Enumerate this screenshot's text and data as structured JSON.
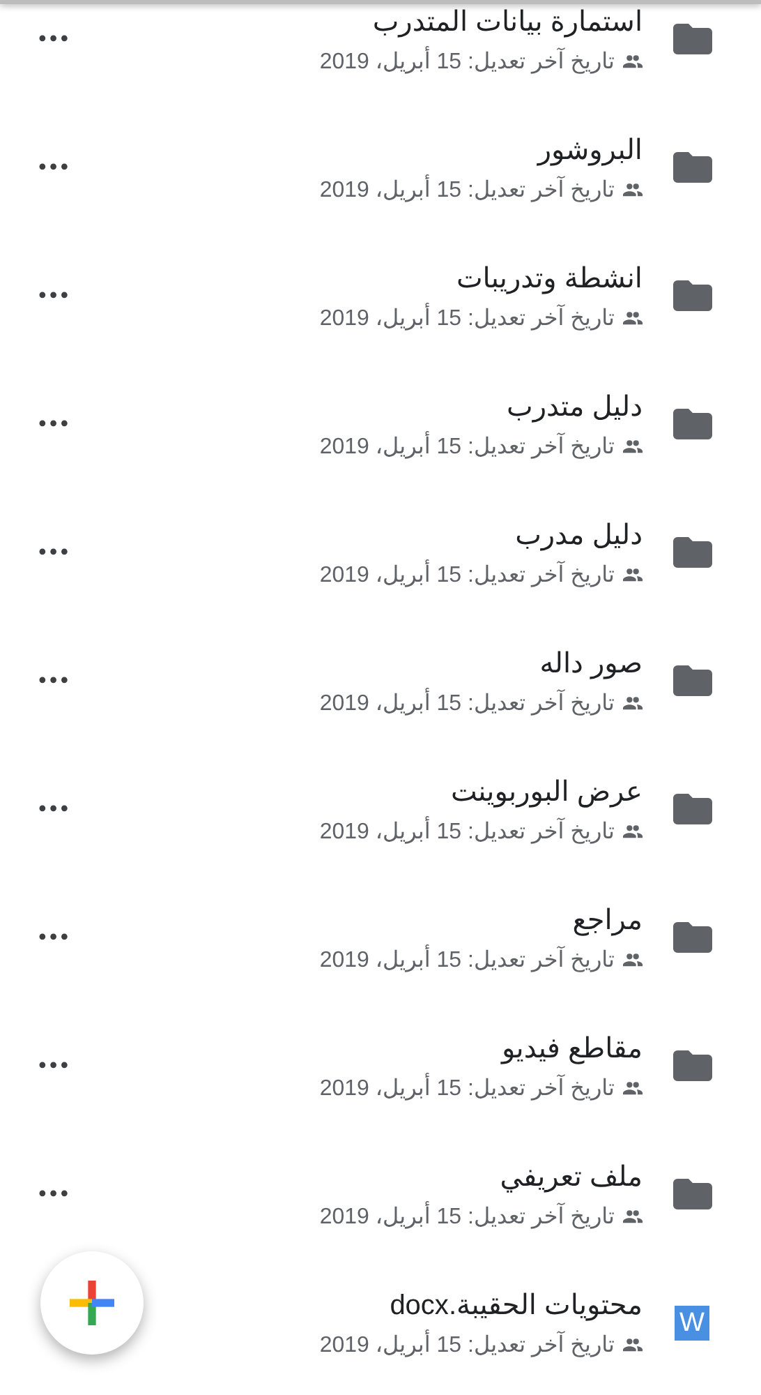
{
  "files": [
    {
      "kind": "folder",
      "name": "استمارة بيانات المتدرب",
      "modified": "تاريخ آخر تعديل: 15 أبريل، 2019",
      "shared": true,
      "menu": "•••"
    },
    {
      "kind": "folder",
      "name": "البروشور",
      "modified": "تاريخ آخر تعديل: 15 أبريل، 2019",
      "shared": true,
      "menu": "•••"
    },
    {
      "kind": "folder",
      "name": "انشطة وتدريبات",
      "modified": "تاريخ آخر تعديل: 15 أبريل، 2019",
      "shared": true,
      "menu": "•••"
    },
    {
      "kind": "folder",
      "name": "دليل متدرب",
      "modified": "تاريخ آخر تعديل: 15 أبريل، 2019",
      "shared": true,
      "menu": "•••"
    },
    {
      "kind": "folder",
      "name": "دليل مدرب",
      "modified": "تاريخ آخر تعديل: 15 أبريل، 2019",
      "shared": true,
      "menu": "•••"
    },
    {
      "kind": "folder",
      "name": "صور داله",
      "modified": "تاريخ آخر تعديل: 15 أبريل، 2019",
      "shared": true,
      "menu": "•••"
    },
    {
      "kind": "folder",
      "name": "عرض البوربوينت",
      "modified": "تاريخ آخر تعديل: 15 أبريل، 2019",
      "shared": true,
      "menu": "•••"
    },
    {
      "kind": "folder",
      "name": "مراجع",
      "modified": "تاريخ آخر تعديل: 15 أبريل، 2019",
      "shared": true,
      "menu": "•••"
    },
    {
      "kind": "folder",
      "name": "مقاطع فيديو",
      "modified": "تاريخ آخر تعديل: 15 أبريل، 2019",
      "shared": true,
      "menu": "•••"
    },
    {
      "kind": "folder",
      "name": "ملف تعريفي",
      "modified": "تاريخ آخر تعديل: 15 أبريل، 2019",
      "shared": true,
      "menu": "•••"
    },
    {
      "kind": "word",
      "icon_letter": "W",
      "name": "محتويات الحقيبة.docx",
      "modified": "تاريخ آخر تعديل: 15 أبريل، 2019",
      "shared": true
    }
  ]
}
